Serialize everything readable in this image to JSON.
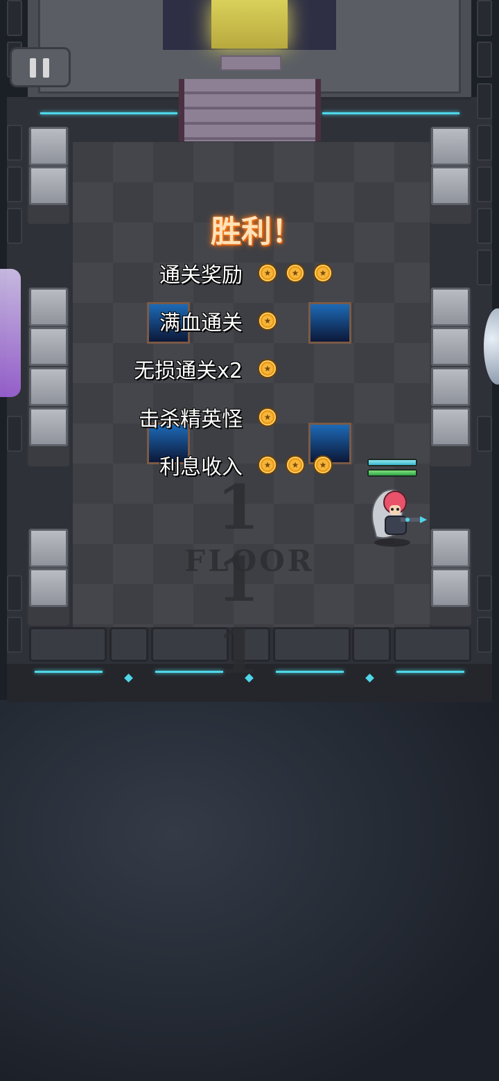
{
  "hud": {
    "pause_icon": "pause-icon"
  },
  "result": {
    "title": "胜利！",
    "rewards": [
      {
        "label": "通关奖励",
        "coins": 3
      },
      {
        "label": "满血通关",
        "coins": 1
      },
      {
        "label": "无损通关x2",
        "coins": 1
      },
      {
        "label": "击杀精英怪",
        "coins": 1
      },
      {
        "label": "利息收入",
        "coins": 3
      }
    ]
  },
  "floor_marker": {
    "number": "1 1 1",
    "word": "FLOOR"
  },
  "player": {
    "shield_level": 1.0,
    "health_level": 1.0
  },
  "colors": {
    "accent_cyan": "#4fd7e9",
    "coin_gold": "#f7b63b",
    "victory_glow": "#ff7a1a"
  }
}
